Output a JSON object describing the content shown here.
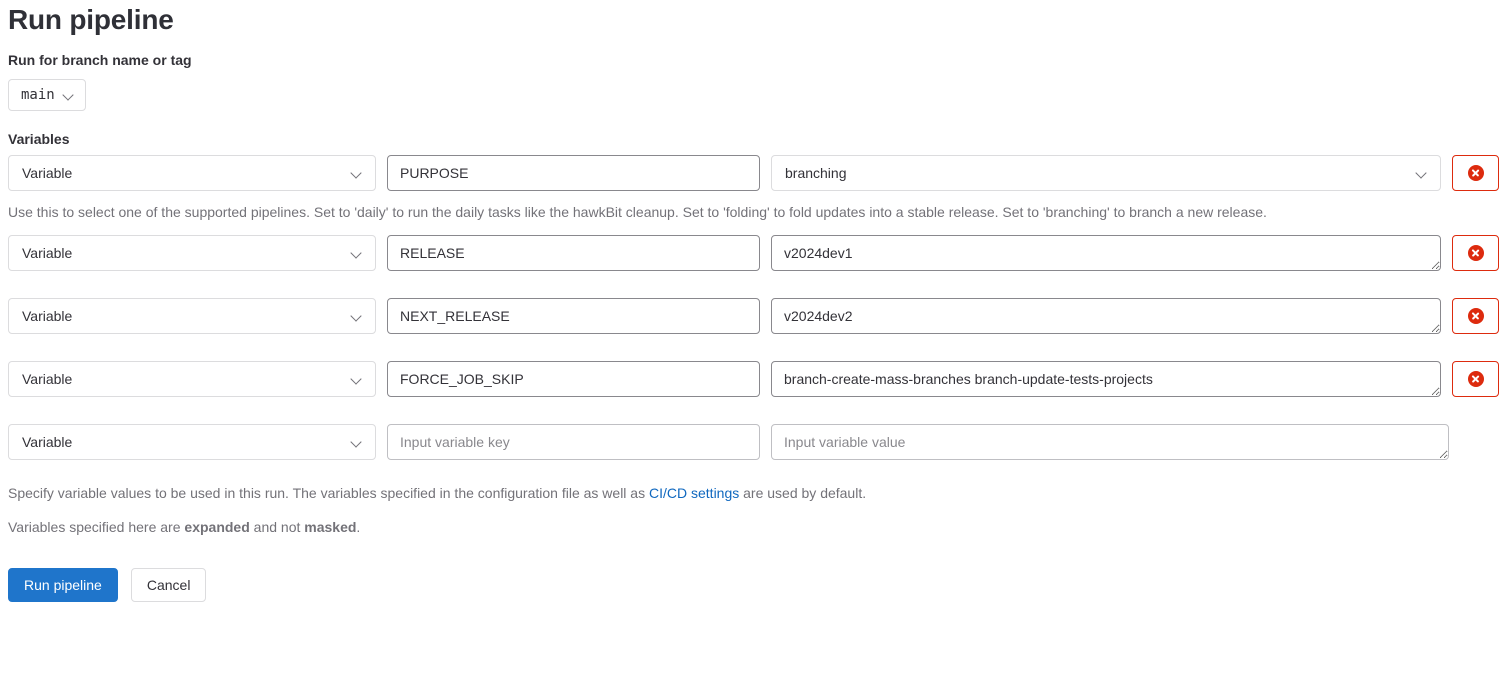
{
  "page": {
    "title": "Run pipeline",
    "branch_field_label": "Run for branch name or tag",
    "branch_value": "main",
    "variables_label": "Variables"
  },
  "variable_rows": [
    {
      "type_label": "Variable",
      "key": "PURPOSE",
      "value": "branching",
      "value_control": "select",
      "has_delete": true,
      "help_text": "Use this to select one of the supported pipelines. Set to 'daily' to run the daily tasks like the hawkBit cleanup. Set to 'folding' to fold updates into a stable release. Set to 'branching' to branch a new release."
    },
    {
      "type_label": "Variable",
      "key": "RELEASE",
      "value": "v2024dev1",
      "value_control": "textarea",
      "has_delete": true
    },
    {
      "type_label": "Variable",
      "key": "NEXT_RELEASE",
      "value": "v2024dev2",
      "value_control": "textarea",
      "has_delete": true
    },
    {
      "type_label": "Variable",
      "key": "FORCE_JOB_SKIP",
      "value": "branch-create-mass-branches branch-update-tests-projects",
      "value_control": "textarea",
      "has_delete": true
    },
    {
      "type_label": "Variable",
      "key": "",
      "key_placeholder": "Input variable key",
      "value": "",
      "value_placeholder": "Input variable value",
      "value_control": "textarea",
      "has_delete": false
    }
  ],
  "footer": {
    "note_part1": "Specify variable values to be used in this run. The variables specified in the configuration file as well as ",
    "note_link": "CI/CD settings",
    "note_part2": " are used by default.",
    "expanded_part1": "Variables specified here are ",
    "expanded_bold1": "expanded",
    "expanded_part2": " and not ",
    "expanded_bold2": "masked",
    "expanded_part3": "."
  },
  "actions": {
    "submit_label": "Run pipeline",
    "cancel_label": "Cancel"
  },
  "colors": {
    "primary": "#1f75cb",
    "danger": "#dd2b0e",
    "link": "#1068bf",
    "muted_text": "#737278"
  },
  "icons": {
    "chevron_down": "chevron-down-icon",
    "remove": "remove-circle-icon"
  }
}
